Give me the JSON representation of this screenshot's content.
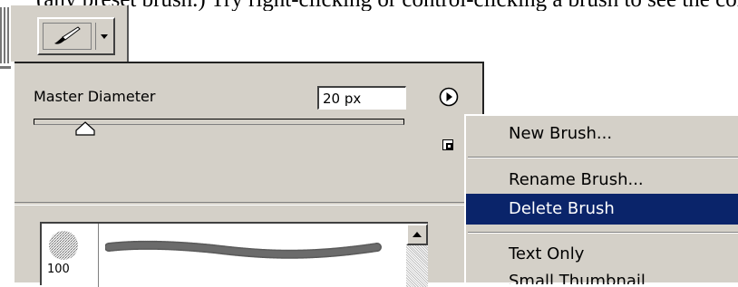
{
  "background_text": "(any preset brush.) Try right-clicking or control-clicking a brush to see the context menu.",
  "brush_panel": {
    "master_diameter_label": "Master Diameter",
    "diameter_value": "20 px",
    "slider_fraction": 0.14,
    "brushes": [
      {
        "size": "100"
      }
    ]
  },
  "flyout_menu": {
    "items": [
      {
        "label": "New Brush...",
        "state": "normal"
      },
      {
        "label": "Rename Brush...",
        "state": "normal"
      },
      {
        "label": "Delete Brush",
        "state": "selected"
      },
      {
        "label": "Text Only",
        "state": "normal"
      },
      {
        "label": "Small Thumbnail",
        "state": "cut-off"
      }
    ]
  },
  "colors": {
    "panel_bg": "#d4d0c8",
    "menu_highlight": "#0a246a",
    "highlight_text": "#ffffff"
  },
  "icons": {
    "tool_preview": "brush-icon",
    "dropdown": "triangle-down-icon",
    "panel_menu": "circle-arrow-right-icon",
    "new_brush": "new-preset-icon",
    "scroll_up": "triangle-up-icon"
  }
}
